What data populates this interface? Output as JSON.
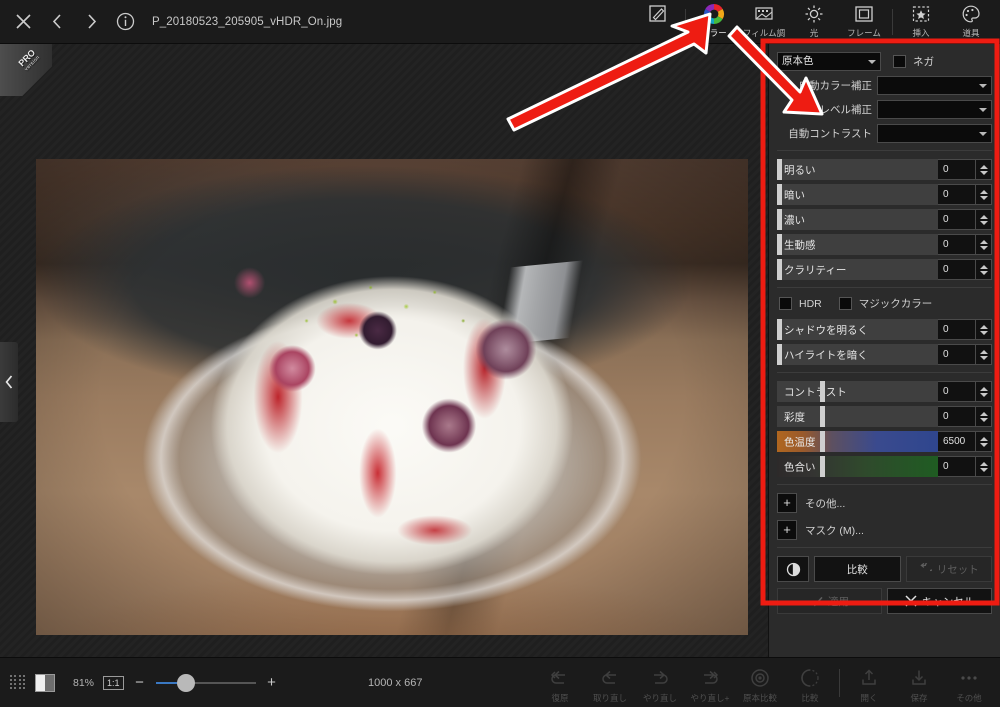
{
  "app": {
    "filename": "P_20180523_205905_vHDR_On.jpg",
    "accent_red": "#ee1c12",
    "panel_bg": "#2b2b2b"
  },
  "topbar": {
    "close_label": "close-icon",
    "prev_label": "prev-icon",
    "next_label": "next-icon",
    "info_label": "info-icon",
    "tools": [
      {
        "id": "edit",
        "label": ""
      },
      {
        "id": "color",
        "label": "カラー"
      },
      {
        "id": "film",
        "label": "フィルム調"
      },
      {
        "id": "light",
        "label": "光"
      },
      {
        "id": "frame",
        "label": "フレーム"
      },
      {
        "id": "insert",
        "label": "挿入"
      },
      {
        "id": "tools",
        "label": "道具"
      }
    ]
  },
  "canvas": {
    "pro_badge": "PRO",
    "pro_sub": "version",
    "collapse_left": "chevron-left-icon",
    "recenter": "recenter-button"
  },
  "panel": {
    "preset": {
      "value": "原本色",
      "options": [
        "原本色"
      ]
    },
    "negative": {
      "label": "ネガ",
      "checked": false
    },
    "auto_rows": [
      {
        "label": "自動カラー補正",
        "value": ""
      },
      {
        "label": "自動レベル補正",
        "value": ""
      },
      {
        "label": "自動コントラスト",
        "value": ""
      }
    ],
    "sliders_a": [
      {
        "label": "明るい",
        "value": "0",
        "pos": 0,
        "style": "plain"
      },
      {
        "label": "暗い",
        "value": "0",
        "pos": 0,
        "style": "plain"
      },
      {
        "label": "濃い",
        "value": "0",
        "pos": 0,
        "style": "plain"
      },
      {
        "label": "生動感",
        "value": "0",
        "pos": 0,
        "style": "plain"
      },
      {
        "label": "クラリティー",
        "value": "0",
        "pos": 0,
        "style": "plain"
      }
    ],
    "toggles": [
      {
        "label": "HDR",
        "checked": false
      },
      {
        "label": "マジックカラー",
        "checked": false
      }
    ],
    "sliders_b": [
      {
        "label": "シャドウを明るく",
        "value": "0",
        "pos": 0,
        "style": "plain"
      },
      {
        "label": "ハイライトを暗く",
        "value": "0",
        "pos": 0,
        "style": "plain"
      }
    ],
    "sliders_c": [
      {
        "label": "コントラスト",
        "value": "0",
        "pos": 27,
        "style": "plain"
      },
      {
        "label": "彩度",
        "value": "0",
        "pos": 27,
        "style": "plain"
      },
      {
        "label": "色温度",
        "value": "6500",
        "pos": 27,
        "style": "temp"
      },
      {
        "label": "色合い",
        "value": "0",
        "pos": 27,
        "style": "tint"
      }
    ],
    "expanders": [
      {
        "label": "その他..."
      },
      {
        "label": "マスク (M)..."
      }
    ],
    "actions": {
      "split_view": "split-view-icon",
      "compare": "比較",
      "reset": "リセット",
      "apply": "適用",
      "cancel": "キャンセル"
    }
  },
  "bottombar": {
    "zoom_percent": "81%",
    "one_to_one": "1:1",
    "minus": "−",
    "plus": "+",
    "dimensions": "1000 x 667",
    "buttons": [
      {
        "id": "restore",
        "label": "復原"
      },
      {
        "id": "undo",
        "label": "取り直し"
      },
      {
        "id": "redo",
        "label": "やり直し"
      },
      {
        "id": "redo_all",
        "label": "やり直し+"
      },
      {
        "id": "orig_cmp",
        "label": "原本比較"
      },
      {
        "id": "compare",
        "label": "比較"
      },
      {
        "id": "open",
        "label": "開く"
      },
      {
        "id": "save",
        "label": "保存"
      },
      {
        "id": "more",
        "label": "その他"
      }
    ]
  },
  "annotations": {
    "arrow1": "red-arrow-to-color-tool",
    "arrow2": "red-arrow-to-panel",
    "box": "red-highlight-rectangle"
  }
}
